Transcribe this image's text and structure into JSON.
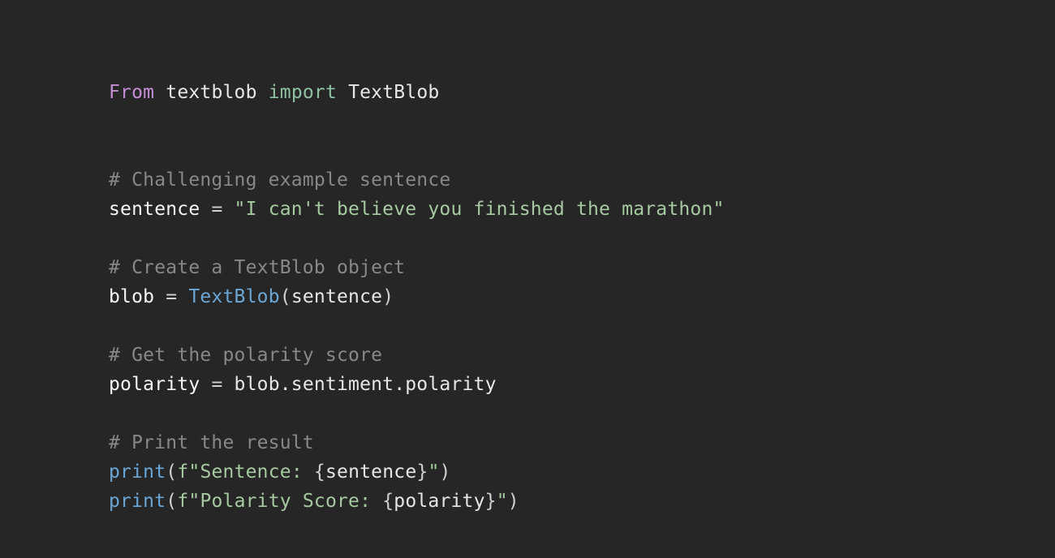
{
  "code": {
    "line1": {
      "from": "From",
      "mod": "textblob",
      "import": "import",
      "cls": "TextBlob"
    },
    "line4": {
      "comment": "# Challenging example sentence"
    },
    "line5": {
      "lhs": "sentence",
      "eq": " = ",
      "str": "\"I can't believe you finished the marathon\""
    },
    "line7": {
      "comment": "# Create a TextBlob object"
    },
    "line8": {
      "lhs": "blob",
      "eq": " = ",
      "ctor": "TextBlob",
      "lp": "(",
      "arg": "sentence",
      "rp": ")"
    },
    "line10": {
      "comment": "# Get the polarity score"
    },
    "line11": {
      "lhs": "polarity",
      "eq": " = ",
      "rhs": "blob.sentiment.polarity"
    },
    "line13": {
      "comment": "# Print the result"
    },
    "line14": {
      "fn": "print",
      "lp": "(",
      "pfx": "f",
      "q1": "\"",
      "txt": "Sentence: ",
      "lb": "{",
      "var": "sentence",
      "rb": "}",
      "q2": "\"",
      "rp": ")"
    },
    "line15": {
      "fn": "print",
      "lp": "(",
      "pfx": "f",
      "q1": "\"",
      "txt": "Polarity Score: ",
      "lb": "{",
      "var": "polarity",
      "rb": "}",
      "q2": "\"",
      "rp": ")"
    }
  }
}
